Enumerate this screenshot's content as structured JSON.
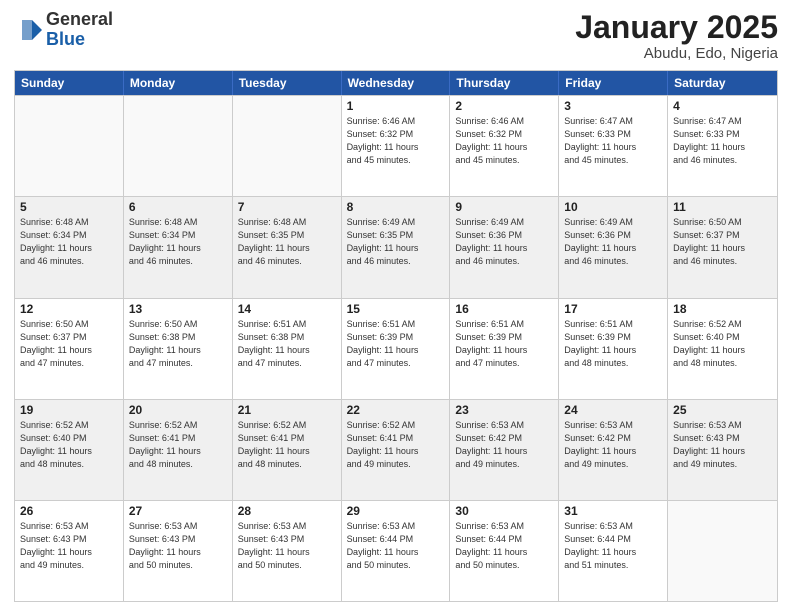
{
  "logo": {
    "general": "General",
    "blue": "Blue"
  },
  "header": {
    "title": "January 2025",
    "subtitle": "Abudu, Edo, Nigeria"
  },
  "weekdays": [
    "Sunday",
    "Monday",
    "Tuesday",
    "Wednesday",
    "Thursday",
    "Friday",
    "Saturday"
  ],
  "weeks": [
    [
      {
        "day": "",
        "info": ""
      },
      {
        "day": "",
        "info": ""
      },
      {
        "day": "",
        "info": ""
      },
      {
        "day": "1",
        "info": "Sunrise: 6:46 AM\nSunset: 6:32 PM\nDaylight: 11 hours\nand 45 minutes."
      },
      {
        "day": "2",
        "info": "Sunrise: 6:46 AM\nSunset: 6:32 PM\nDaylight: 11 hours\nand 45 minutes."
      },
      {
        "day": "3",
        "info": "Sunrise: 6:47 AM\nSunset: 6:33 PM\nDaylight: 11 hours\nand 45 minutes."
      },
      {
        "day": "4",
        "info": "Sunrise: 6:47 AM\nSunset: 6:33 PM\nDaylight: 11 hours\nand 46 minutes."
      }
    ],
    [
      {
        "day": "5",
        "info": "Sunrise: 6:48 AM\nSunset: 6:34 PM\nDaylight: 11 hours\nand 46 minutes."
      },
      {
        "day": "6",
        "info": "Sunrise: 6:48 AM\nSunset: 6:34 PM\nDaylight: 11 hours\nand 46 minutes."
      },
      {
        "day": "7",
        "info": "Sunrise: 6:48 AM\nSunset: 6:35 PM\nDaylight: 11 hours\nand 46 minutes."
      },
      {
        "day": "8",
        "info": "Sunrise: 6:49 AM\nSunset: 6:35 PM\nDaylight: 11 hours\nand 46 minutes."
      },
      {
        "day": "9",
        "info": "Sunrise: 6:49 AM\nSunset: 6:36 PM\nDaylight: 11 hours\nand 46 minutes."
      },
      {
        "day": "10",
        "info": "Sunrise: 6:49 AM\nSunset: 6:36 PM\nDaylight: 11 hours\nand 46 minutes."
      },
      {
        "day": "11",
        "info": "Sunrise: 6:50 AM\nSunset: 6:37 PM\nDaylight: 11 hours\nand 46 minutes."
      }
    ],
    [
      {
        "day": "12",
        "info": "Sunrise: 6:50 AM\nSunset: 6:37 PM\nDaylight: 11 hours\nand 47 minutes."
      },
      {
        "day": "13",
        "info": "Sunrise: 6:50 AM\nSunset: 6:38 PM\nDaylight: 11 hours\nand 47 minutes."
      },
      {
        "day": "14",
        "info": "Sunrise: 6:51 AM\nSunset: 6:38 PM\nDaylight: 11 hours\nand 47 minutes."
      },
      {
        "day": "15",
        "info": "Sunrise: 6:51 AM\nSunset: 6:39 PM\nDaylight: 11 hours\nand 47 minutes."
      },
      {
        "day": "16",
        "info": "Sunrise: 6:51 AM\nSunset: 6:39 PM\nDaylight: 11 hours\nand 47 minutes."
      },
      {
        "day": "17",
        "info": "Sunrise: 6:51 AM\nSunset: 6:39 PM\nDaylight: 11 hours\nand 48 minutes."
      },
      {
        "day": "18",
        "info": "Sunrise: 6:52 AM\nSunset: 6:40 PM\nDaylight: 11 hours\nand 48 minutes."
      }
    ],
    [
      {
        "day": "19",
        "info": "Sunrise: 6:52 AM\nSunset: 6:40 PM\nDaylight: 11 hours\nand 48 minutes."
      },
      {
        "day": "20",
        "info": "Sunrise: 6:52 AM\nSunset: 6:41 PM\nDaylight: 11 hours\nand 48 minutes."
      },
      {
        "day": "21",
        "info": "Sunrise: 6:52 AM\nSunset: 6:41 PM\nDaylight: 11 hours\nand 48 minutes."
      },
      {
        "day": "22",
        "info": "Sunrise: 6:52 AM\nSunset: 6:41 PM\nDaylight: 11 hours\nand 49 minutes."
      },
      {
        "day": "23",
        "info": "Sunrise: 6:53 AM\nSunset: 6:42 PM\nDaylight: 11 hours\nand 49 minutes."
      },
      {
        "day": "24",
        "info": "Sunrise: 6:53 AM\nSunset: 6:42 PM\nDaylight: 11 hours\nand 49 minutes."
      },
      {
        "day": "25",
        "info": "Sunrise: 6:53 AM\nSunset: 6:43 PM\nDaylight: 11 hours\nand 49 minutes."
      }
    ],
    [
      {
        "day": "26",
        "info": "Sunrise: 6:53 AM\nSunset: 6:43 PM\nDaylight: 11 hours\nand 49 minutes."
      },
      {
        "day": "27",
        "info": "Sunrise: 6:53 AM\nSunset: 6:43 PM\nDaylight: 11 hours\nand 50 minutes."
      },
      {
        "day": "28",
        "info": "Sunrise: 6:53 AM\nSunset: 6:43 PM\nDaylight: 11 hours\nand 50 minutes."
      },
      {
        "day": "29",
        "info": "Sunrise: 6:53 AM\nSunset: 6:44 PM\nDaylight: 11 hours\nand 50 minutes."
      },
      {
        "day": "30",
        "info": "Sunrise: 6:53 AM\nSunset: 6:44 PM\nDaylight: 11 hours\nand 50 minutes."
      },
      {
        "day": "31",
        "info": "Sunrise: 6:53 AM\nSunset: 6:44 PM\nDaylight: 11 hours\nand 51 minutes."
      },
      {
        "day": "",
        "info": ""
      }
    ]
  ]
}
